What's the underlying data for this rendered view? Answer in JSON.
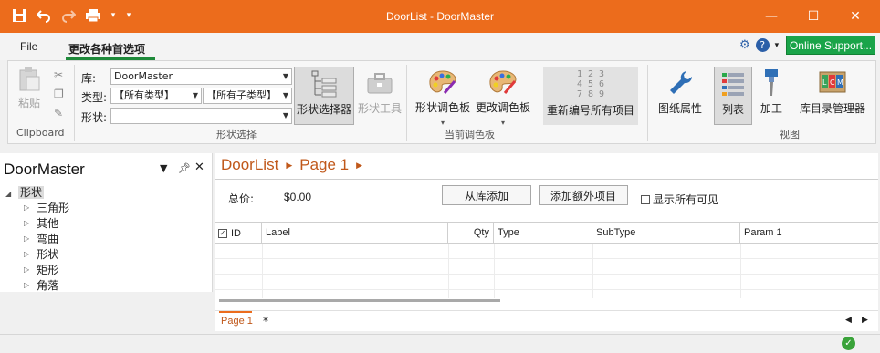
{
  "window": {
    "title": "DoorList - DoorMaster"
  },
  "tabs": {
    "file": "File",
    "active": "更改各种首选项"
  },
  "support": {
    "label": "Online Support..."
  },
  "ribbon": {
    "clipboard": {
      "paste": "粘贴",
      "group": "Clipboard"
    },
    "shape_select": {
      "lib_label": "库:",
      "lib_value": "DoorMaster",
      "type_label": "类型:",
      "type_value": "【所有类型】",
      "subtype_value": "【所有子类型】",
      "shape_label": "形状:",
      "shape_value": "",
      "selector": "形状选择器",
      "tool": "形状工具",
      "group": "形状选择"
    },
    "palette": {
      "shape_palette": "形状调色板",
      "change_palette": "更改调色板",
      "group": "当前调色板"
    },
    "renumber": {
      "label": "重新编号所有项目",
      "digits": [
        "1 2 3",
        "4 5 6",
        "7 8 9"
      ]
    },
    "view": {
      "drawing_props": "图纸属性",
      "list": "列表",
      "process": "加工",
      "lib_manager": "库目录管理器",
      "group": "视图"
    }
  },
  "panel": {
    "title": "DoorMaster",
    "root": "形状",
    "items": [
      "三角形",
      "其他",
      "弯曲",
      "形状",
      "矩形",
      "角落"
    ]
  },
  "main": {
    "breadcrumb": [
      "DoorList",
      "Page 1"
    ],
    "total_label": "总价:",
    "total_value": "$0.00",
    "add_from_lib": "从库添加",
    "add_extra": "添加额外项目",
    "show_all": "显示所有可见",
    "columns": [
      "ID",
      "Label",
      "Qty",
      "Type",
      "SubType",
      "Param 1"
    ],
    "page_tab": "Page 1",
    "new_tab": "*"
  },
  "colors": {
    "accent": "#ec6c1c",
    "support": "#1aa449",
    "breadcrumb": "#c0581a"
  }
}
